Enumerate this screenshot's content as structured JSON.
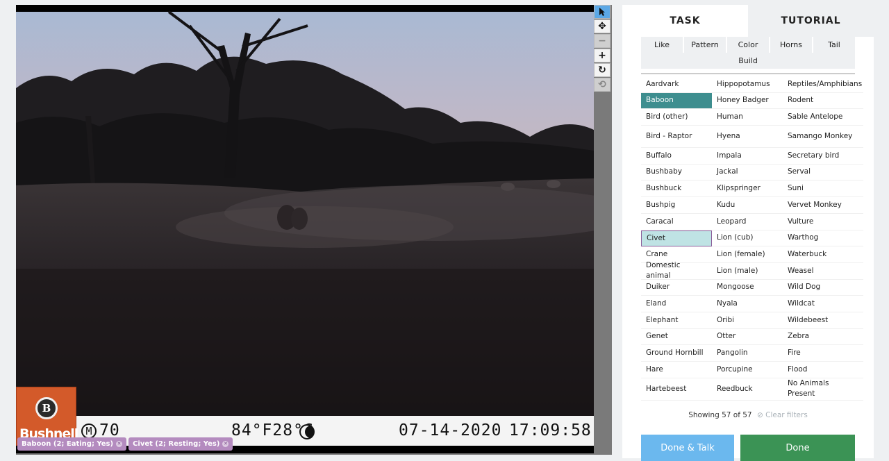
{
  "camera": {
    "brand": "Bushnell",
    "moon_label": "M",
    "reading": "70",
    "temperature": "84°F28°C",
    "date": "07-14-2020",
    "time": "17:09:58"
  },
  "annotations": [
    {
      "label": "Baboon (2; Eating; Yes)"
    },
    {
      "label": "Civet (2; Resting; Yes)"
    }
  ],
  "tools": [
    "pointer-icon",
    "move-icon",
    "zoom-out-icon",
    "zoom-in-icon",
    "rotate-icon",
    "reset-icon"
  ],
  "panel": {
    "tabs": {
      "task": "TASK",
      "tutorial": "TUTORIAL"
    },
    "filters": [
      "Like",
      "Pattern",
      "Color",
      "Horns",
      "Tail"
    ],
    "filter_build": "Build",
    "species": [
      "Aardvark",
      "Hippopotamus",
      "Reptiles/Amphibians",
      "Baboon",
      "Honey Badger",
      "Rodent",
      "Bird (other)",
      "Human",
      "Sable Antelope",
      "Bird - Raptor",
      "Hyena",
      "Samango Monkey",
      "Buffalo",
      "Impala",
      "Secretary bird",
      "Bushbaby",
      "Jackal",
      "Serval",
      "Bushbuck",
      "Klipspringer",
      "Suni",
      "Bushpig",
      "Kudu",
      "Vervet Monkey",
      "Caracal",
      "Leopard",
      "Vulture",
      "Civet",
      "Lion (cub)",
      "Warthog",
      "Crane",
      "Lion (female)",
      "Waterbuck",
      "Domestic animal",
      "Lion (male)",
      "Weasel",
      "Duiker",
      "Mongoose",
      "Wild Dog",
      "Eland",
      "Nyala",
      "Wildcat",
      "Elephant",
      "Oribi",
      "Wildebeest",
      "Genet",
      "Otter",
      "Zebra",
      "Ground Hornbill",
      "Pangolin",
      "Fire",
      "Hare",
      "Porcupine",
      "Flood",
      "Hartebeest",
      "Reedbuck",
      "No Animals Present"
    ],
    "selected": "Baboon",
    "highlighted": "Civet",
    "showing": "Showing 57 of 57",
    "clear_filters": "Clear filters",
    "done_talk": "Done & Talk",
    "done": "Done"
  }
}
